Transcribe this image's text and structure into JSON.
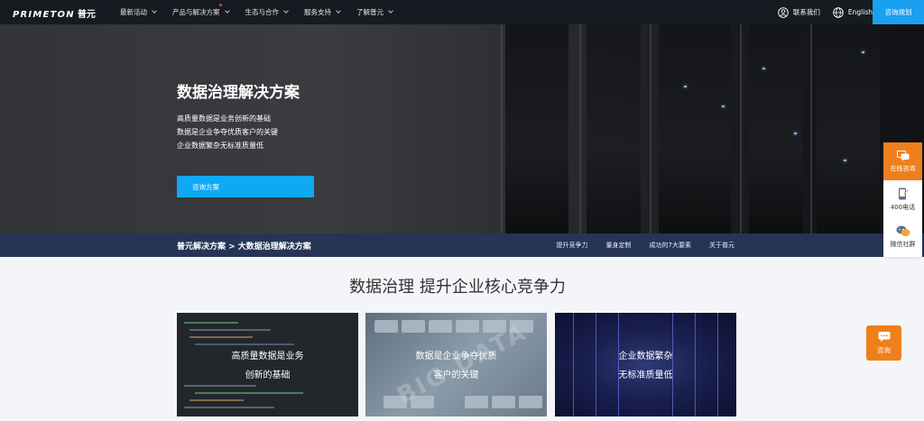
{
  "nav": {
    "logo_text": "PRIMETON",
    "logo_cn": "普元",
    "menu": [
      {
        "label": "最新活动",
        "hot": false
      },
      {
        "label": "产品与解决方案",
        "hot": true
      },
      {
        "label": "生态与合作",
        "hot": false
      },
      {
        "label": "服务支持",
        "hot": false
      },
      {
        "label": "了解普元",
        "hot": false
      }
    ],
    "contact_label": "联系我们",
    "language_label": "English",
    "consult_label": "咨询规划"
  },
  "hero": {
    "title": "数据治理解决方案",
    "lines": [
      "高质量数据是业务创新的基础",
      "数据是企业争夺优质客户的关键",
      "企业数据繁杂无标准质量低"
    ],
    "button_label": "咨询方案"
  },
  "breadcrumb": {
    "text": "普元解决方案 > 大数据治理解决方案"
  },
  "subnav": [
    "提升竞争力",
    "量身定制",
    "成功的7大要素",
    "关于普元"
  ],
  "side_panel": [
    {
      "label": "在线咨询",
      "icon": "chat-icon"
    },
    {
      "label": "400电话",
      "icon": "phone-icon"
    },
    {
      "label": "微信社群",
      "icon": "wechat-icon"
    }
  ],
  "float_consult_label": "咨询",
  "section": {
    "title": "数据治理 提升企业核心竞争力",
    "cards": [
      {
        "line1": "高质量数据是业务",
        "line2": "创新的基础"
      },
      {
        "line1": "数据是企业争夺优质",
        "line2": "客户的关键",
        "bg_text": "BIG DATA"
      },
      {
        "line1": "企业数据繁杂",
        "line2": "无标准质量低"
      }
    ]
  },
  "colors": {
    "nav_bg": "#161a21",
    "accent_blue": "#1aa0f0",
    "breadcrumb_bg": "#263555",
    "accent_orange": "#ef7f1b"
  }
}
